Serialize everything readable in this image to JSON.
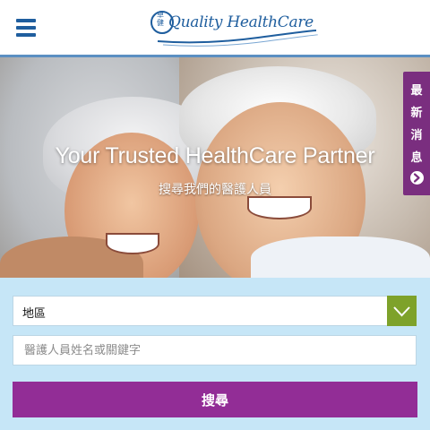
{
  "header": {
    "menu_icon": "hamburger-icon",
    "logo_text": "Quality HealthCare",
    "logo_chars": "卓健",
    "accent_color": "#1f5e9e"
  },
  "hero": {
    "title": "Your Trusted HealthCare Partner",
    "subtitle": "搜尋我們的醫護人員"
  },
  "side_tab": {
    "chars": [
      "最",
      "新",
      "消",
      "息"
    ],
    "icon": "arrow-right-circle-icon",
    "color": "#7a2e7f"
  },
  "search": {
    "district_label": "地區",
    "district_icon": "chevron-down-icon",
    "keyword_placeholder": "醫護人員姓名或關鍵字",
    "submit_label": "搜尋",
    "submit_color": "#922d96",
    "background_color": "#c6e6f7"
  }
}
